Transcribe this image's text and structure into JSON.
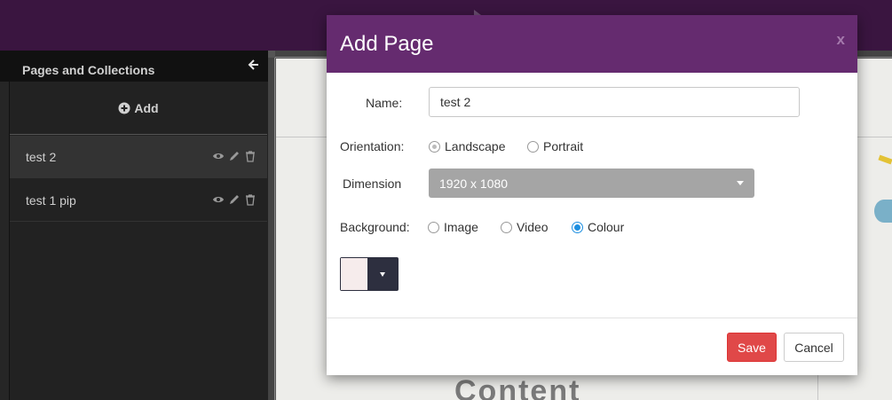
{
  "sidebar": {
    "title": "Pages and Collections",
    "add_label": "Add",
    "pages": [
      {
        "name": "test 2",
        "active": true
      },
      {
        "name": "test 1 pip",
        "active": false
      }
    ]
  },
  "canvas": {
    "content_label": "Content"
  },
  "modal": {
    "title": "Add Page",
    "close_label": "x",
    "name_label": "Name:",
    "name_value": "test 2",
    "orientation_label": "Orientation:",
    "orientation_options": [
      "Landscape",
      "Portrait"
    ],
    "orientation_selected": "Landscape",
    "dimension_label": "Dimension",
    "dimension_value": "1920 x 1080",
    "background_label": "Background:",
    "background_options": [
      "Image",
      "Video",
      "Colour"
    ],
    "background_selected": "Colour",
    "colour_value": "#f6ecec",
    "save_label": "Save",
    "cancel_label": "Cancel"
  },
  "colors": {
    "header": "#652b6f",
    "topbar": "#3a1540",
    "save": "#e04848",
    "radio_selected": "#1e8fe0"
  }
}
